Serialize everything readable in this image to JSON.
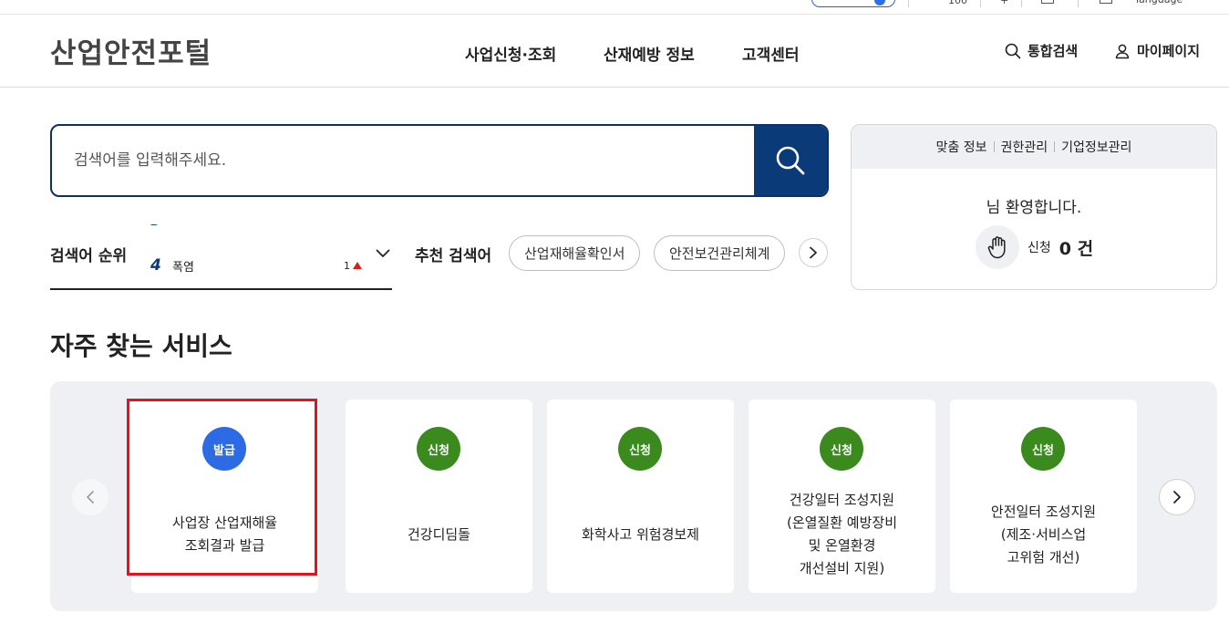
{
  "util": {
    "language_label": "language"
  },
  "header": {
    "logo": "산업안전포털",
    "nav": [
      "사업신청·조회",
      "산재예방 정보",
      "고객센터"
    ],
    "integrated_search": "통합검색",
    "mypage": "마이페이지"
  },
  "search": {
    "placeholder": "검색어를 입력해주세요."
  },
  "ranking": {
    "label": "검색어 순위",
    "items": [
      {
        "rank": "4",
        "word": "폭염",
        "change": "1",
        "direction": "up"
      }
    ]
  },
  "recommend": {
    "label": "추천 검색어",
    "chips": [
      "산업재해율확인서",
      "안전보건관리체계"
    ]
  },
  "user_panel": {
    "links": [
      "맞춤 정보",
      "권한관리",
      "기업정보관리"
    ],
    "welcome": "님 환영합니다.",
    "apply_label": "신청",
    "apply_count": "0 건"
  },
  "services": {
    "title": "자주 찾는 서비스",
    "badge_colors": {
      "발급": "#2d6be4",
      "신청": "#3a8a1e"
    },
    "highlight_color": "#e0141e",
    "cards": [
      {
        "badge": "발급",
        "text": "사업장 산업재해율\n조회결과 발급"
      },
      {
        "badge": "신청",
        "text": "건강디딤돌"
      },
      {
        "badge": "신청",
        "text": "화학사고 위험경보제"
      },
      {
        "badge": "신청",
        "text": "건강일터 조성지원\n(온열질환 예방장비\n및 온열환경\n개선설비 지원)"
      },
      {
        "badge": "신청",
        "text": "안전일터 조성지원\n(제조·서비스업\n고위험 개선)"
      }
    ]
  }
}
